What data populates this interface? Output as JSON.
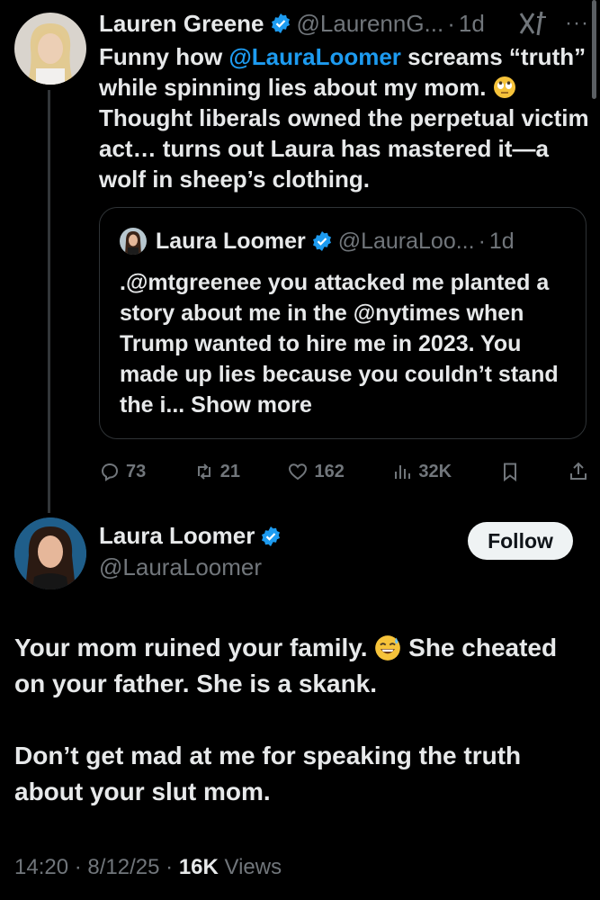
{
  "parent_tweet": {
    "author_name": "Lauren Greene",
    "author_handle": "@LaurennG...",
    "time": "1d",
    "text_before_mention": "Funny how ",
    "mention": "@LauraLoomer",
    "text_part1": " screams “truth” while spinning lies about my mom. ",
    "text_part2": " Thought liberals owned the perpetual victim act… turns out Laura has mastered it—a wolf in sheep’s clothing.",
    "quote": {
      "author_name": "Laura Loomer",
      "author_handle": "@LauraLoo...",
      "time": "1d",
      "text": ".@mtgreenee you attacked me planted a story about me in the @nytimes when Trump wanted to hire me in 2023. You made up lies because you couldn’t stand the i...",
      "show_more": " Show more"
    },
    "actions": {
      "replies": "73",
      "reposts": "21",
      "likes": "162",
      "views": "32K"
    }
  },
  "main_tweet": {
    "author_name": "Laura Loomer",
    "author_handle": "@LauraLoomer",
    "follow_label": "Follow",
    "paragraph1_a": "Your mom ruined your family. ",
    "paragraph1_b": " She cheated on your father. She is a skank.",
    "paragraph2": "Don’t get mad at me for speaking the truth about your slut mom.",
    "time": "14:20",
    "date": "8/12/25",
    "views_count": "16K",
    "views_label": " Views"
  },
  "icons": {
    "verified": "verified-badge-icon",
    "grok": "grok-icon",
    "more": "more-icon",
    "reply": "reply-icon",
    "repost": "repost-icon",
    "like": "heart-icon",
    "views": "views-icon",
    "bookmark": "bookmark-icon",
    "share": "share-icon"
  },
  "colors": {
    "background": "#000000",
    "text": "#e7e9ea",
    "secondary": "#71767b",
    "accent": "#1d9bf0"
  }
}
